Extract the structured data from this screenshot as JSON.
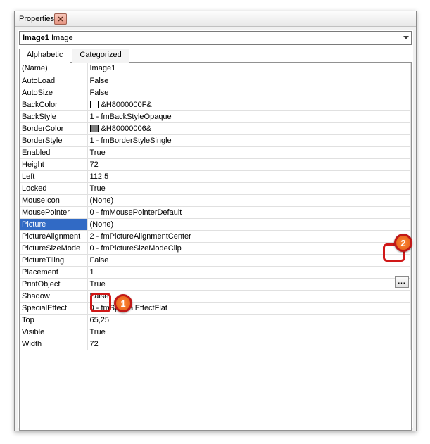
{
  "window": {
    "title": "Properties"
  },
  "object": {
    "name": "Image1",
    "type": "Image"
  },
  "tabs": {
    "alphabetic": "Alphabetic",
    "categorized": "Categorized"
  },
  "selected_row": "Picture",
  "ellipsis_label": "...",
  "properties": [
    {
      "key": "(Name)",
      "value": "Image1"
    },
    {
      "key": "AutoLoad",
      "value": "False"
    },
    {
      "key": "AutoSize",
      "value": "False"
    },
    {
      "key": "BackColor",
      "value": "&H8000000F&",
      "swatch": "#ffffff"
    },
    {
      "key": "BackStyle",
      "value": "1 - fmBackStyleOpaque"
    },
    {
      "key": "BorderColor",
      "value": "&H80000006&",
      "swatch": "#808080"
    },
    {
      "key": "BorderStyle",
      "value": "1 - fmBorderStyleSingle"
    },
    {
      "key": "Enabled",
      "value": "True"
    },
    {
      "key": "Height",
      "value": "72"
    },
    {
      "key": "Left",
      "value": "112,5"
    },
    {
      "key": "Locked",
      "value": "True"
    },
    {
      "key": "MouseIcon",
      "value": "(None)"
    },
    {
      "key": "MousePointer",
      "value": "0 - fmMousePointerDefault"
    },
    {
      "key": "Picture",
      "value": "(None)"
    },
    {
      "key": "PictureAlignment",
      "value": "2 - fmPictureAlignmentCenter"
    },
    {
      "key": "PictureSizeMode",
      "value": "0 - fmPictureSizeModeClip"
    },
    {
      "key": "PictureTiling",
      "value": "False"
    },
    {
      "key": "Placement",
      "value": "1"
    },
    {
      "key": "PrintObject",
      "value": "True"
    },
    {
      "key": "Shadow",
      "value": "False"
    },
    {
      "key": "SpecialEffect",
      "value": "0 - fmSpecialEffectFlat"
    },
    {
      "key": "Top",
      "value": "65,25"
    },
    {
      "key": "Visible",
      "value": "True"
    },
    {
      "key": "Width",
      "value": "72"
    }
  ],
  "annotations": {
    "marker1": "1",
    "marker2": "2"
  }
}
